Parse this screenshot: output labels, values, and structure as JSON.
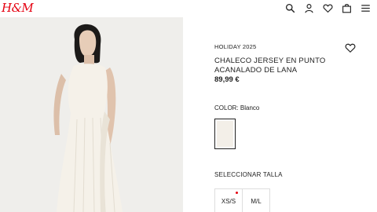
{
  "brand": {
    "logo_text": "H&M",
    "color": "#e50010"
  },
  "header": {
    "icons": [
      "search-icon",
      "user-icon",
      "heart-icon",
      "bag-icon",
      "menu-icon"
    ]
  },
  "product": {
    "collection": "HOLIDAY 2025",
    "title": "CHALECO JERSEY EN PUNTO ACANALADO DE LANA",
    "price": "89,99 €",
    "color_label": "COLOR: Blanco",
    "swatch_color": "#f3efe8",
    "size_label": "SELECCIONAR TALLA",
    "sizes": [
      {
        "label": "XS/S",
        "low_stock": true,
        "dot_color": "#e50010"
      },
      {
        "label": "M/L",
        "low_stock": false
      }
    ]
  }
}
